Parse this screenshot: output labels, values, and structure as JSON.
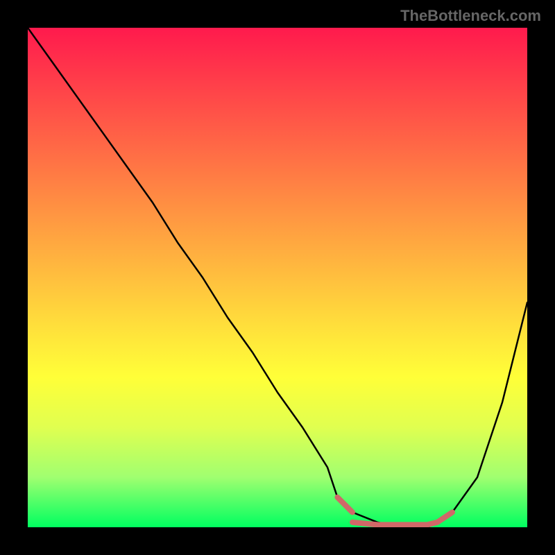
{
  "watermark": "TheBottleneck.com",
  "chart_data": {
    "type": "line",
    "title": "",
    "xlabel": "",
    "ylabel": "",
    "xlim": [
      0,
      100
    ],
    "ylim": [
      0,
      100
    ],
    "series": [
      {
        "name": "bottleneck-curve",
        "x": [
          0,
          5,
          10,
          15,
          20,
          25,
          30,
          35,
          40,
          45,
          50,
          55,
          60,
          62,
          65,
          70,
          75,
          80,
          82,
          85,
          90,
          95,
          100
        ],
        "y": [
          100,
          93,
          86,
          79,
          72,
          65,
          57,
          50,
          42,
          35,
          27,
          20,
          12,
          6,
          3,
          1,
          0,
          0,
          1,
          3,
          10,
          25,
          45
        ],
        "color": "#000000"
      },
      {
        "name": "optimal-zone-left-marker",
        "x": [
          62,
          65
        ],
        "y": [
          6,
          3
        ],
        "color": "#d06868"
      },
      {
        "name": "optimal-zone-flat",
        "x": [
          65,
          70,
          75,
          80,
          82
        ],
        "y": [
          1,
          0.5,
          0.5,
          0.5,
          1
        ],
        "color": "#d06868"
      },
      {
        "name": "optimal-zone-right-marker",
        "x": [
          82,
          85
        ],
        "y": [
          1,
          3
        ],
        "color": "#d06868"
      }
    ],
    "gradient_stops": [
      {
        "pos": 0,
        "color": "#ff1a4d"
      },
      {
        "pos": 50,
        "color": "#ffbf3e"
      },
      {
        "pos": 70,
        "color": "#ffff38"
      },
      {
        "pos": 100,
        "color": "#00ff60"
      }
    ]
  }
}
